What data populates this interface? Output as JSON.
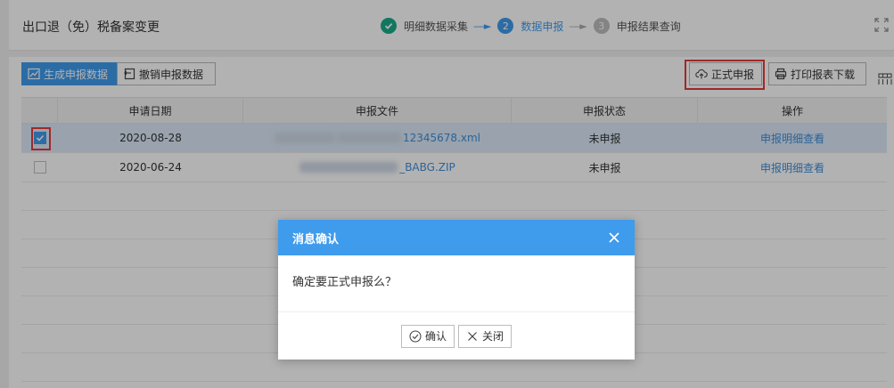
{
  "header": {
    "title": "出口退（免）税备案变更",
    "steps": [
      {
        "index": "✓",
        "label": "明细数据采集",
        "state": "done"
      },
      {
        "index": "2",
        "label": "数据申报",
        "state": "active"
      },
      {
        "index": "3",
        "label": "申报结果查询",
        "state": "pending"
      }
    ],
    "step_arrow": "----►",
    "fullscreen_icon": "expand-icon"
  },
  "toolbar": {
    "generate_label": "生成申报数据",
    "revoke_label": "撤销申报数据",
    "submit_label": "正式申报",
    "print_label": "打印报表下载"
  },
  "table": {
    "columns": [
      "申请日期",
      "申报文件",
      "申报状态",
      "操作"
    ],
    "rows": [
      {
        "date": "2020-08-28",
        "file": "12345678.xml",
        "status": "未申报",
        "action": "申报明细查看",
        "checked": true
      },
      {
        "date": "2020-06-24",
        "file": "_BABG.ZIP",
        "status": "未申报",
        "action": "申报明细查看",
        "checked": false
      }
    ]
  },
  "modal": {
    "title": "消息确认",
    "message": "确定要正式申报么？",
    "confirm_label": "确认",
    "close_label": "关闭"
  },
  "colors": {
    "accent": "#3f9bec",
    "done": "#1aab8a",
    "highlight": "#e33b3b",
    "selected_row": "#dbe9f8"
  }
}
